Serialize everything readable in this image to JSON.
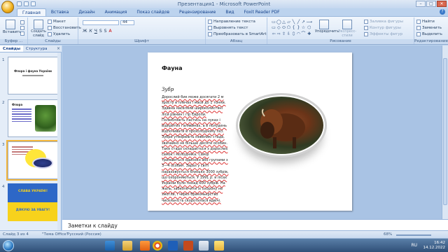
{
  "window": {
    "title": "Презентация1 - Microsoft PowerPoint"
  },
  "tabs": [
    "Главная",
    "Вставка",
    "Дизайн",
    "Анимация",
    "Показ слайдов",
    "Рецензирование",
    "Вид",
    "Foxit Reader PDF"
  ],
  "ribbon": {
    "clipboard": {
      "paste": "Вставить",
      "group": "Буфер ..."
    },
    "slides": {
      "new_slide": "Создать слайд",
      "layout": "Макет",
      "reset": "Восстановить",
      "delete": "Удалить",
      "group": "Слайды"
    },
    "font": {
      "font_size": "44",
      "group": "Шрифт"
    },
    "paragraph": {
      "text_direction": "Направление текста",
      "align_text": "Выровнять текст",
      "smartart": "Преобразовать в SmartArt",
      "group": "Абзац"
    },
    "drawing": {
      "arrange": "Упорядочить",
      "quick_styles": "Экспресс-стили",
      "fill": "Заливка фигуры",
      "outline": "Контур фигуры",
      "effects": "Эффекты фигур",
      "group": "Рисование"
    },
    "editing": {
      "find": "Найти",
      "replace": "Заменить",
      "select": "Выделить",
      "group": "Редактирование"
    }
  },
  "pane": {
    "tab_slides": "Слайды",
    "tab_outline": "Структура",
    "close": "×"
  },
  "thumbnails": [
    {
      "num": "1",
      "title": "Флора і фауна України"
    },
    {
      "num": "2",
      "title": "Флора"
    },
    {
      "num": "3",
      "title": ""
    },
    {
      "num": "4",
      "title": "СЛАВА УКРАЇНІ!",
      "subtitle": "ДЯКУЮ ЗА УВАГУ!"
    }
  ],
  "slide": {
    "heading": "Фауна",
    "subheading": "Зубр",
    "body": "Дорослий бик може досягати 2 м зросту в плечах і маси до 1 тонни. Здавна населяли широколистяні ліси рівнин і гір Європи. Полюбляють пастись на луках і відкритих галявинах, а в полудень відпочивати в прохолодному лісі. Зубри утворюють невеликі стада, звичайно не більше десяти особин. Таке стадо складається з дорослих самок і молодняка. Самці тримаються одиноко або групами з 3—4 особин. Зараз у світі нараховується близько 3000 зубрів, що охороняються. У 1991 р. в лісах України було понад 600 зубрів. На жаль, забезпечити їх охорону не змогли, і через браконьєрство чисельність скоротилася вдвічі."
  },
  "notes": {
    "placeholder": "Заметки к слайду"
  },
  "status": {
    "slide": "Слайд 3 из 4",
    "theme": "\"Тема Office\"",
    "language": "Русский (Россия)",
    "zoom": "68%"
  },
  "taskbar": {
    "lang": "RU",
    "time": "16:42",
    "date": "14.12.2022"
  },
  "colors": {
    "ribbon": "#dbe6f4",
    "accent": "#f4b63a",
    "slide_bg": "#ffffff"
  }
}
